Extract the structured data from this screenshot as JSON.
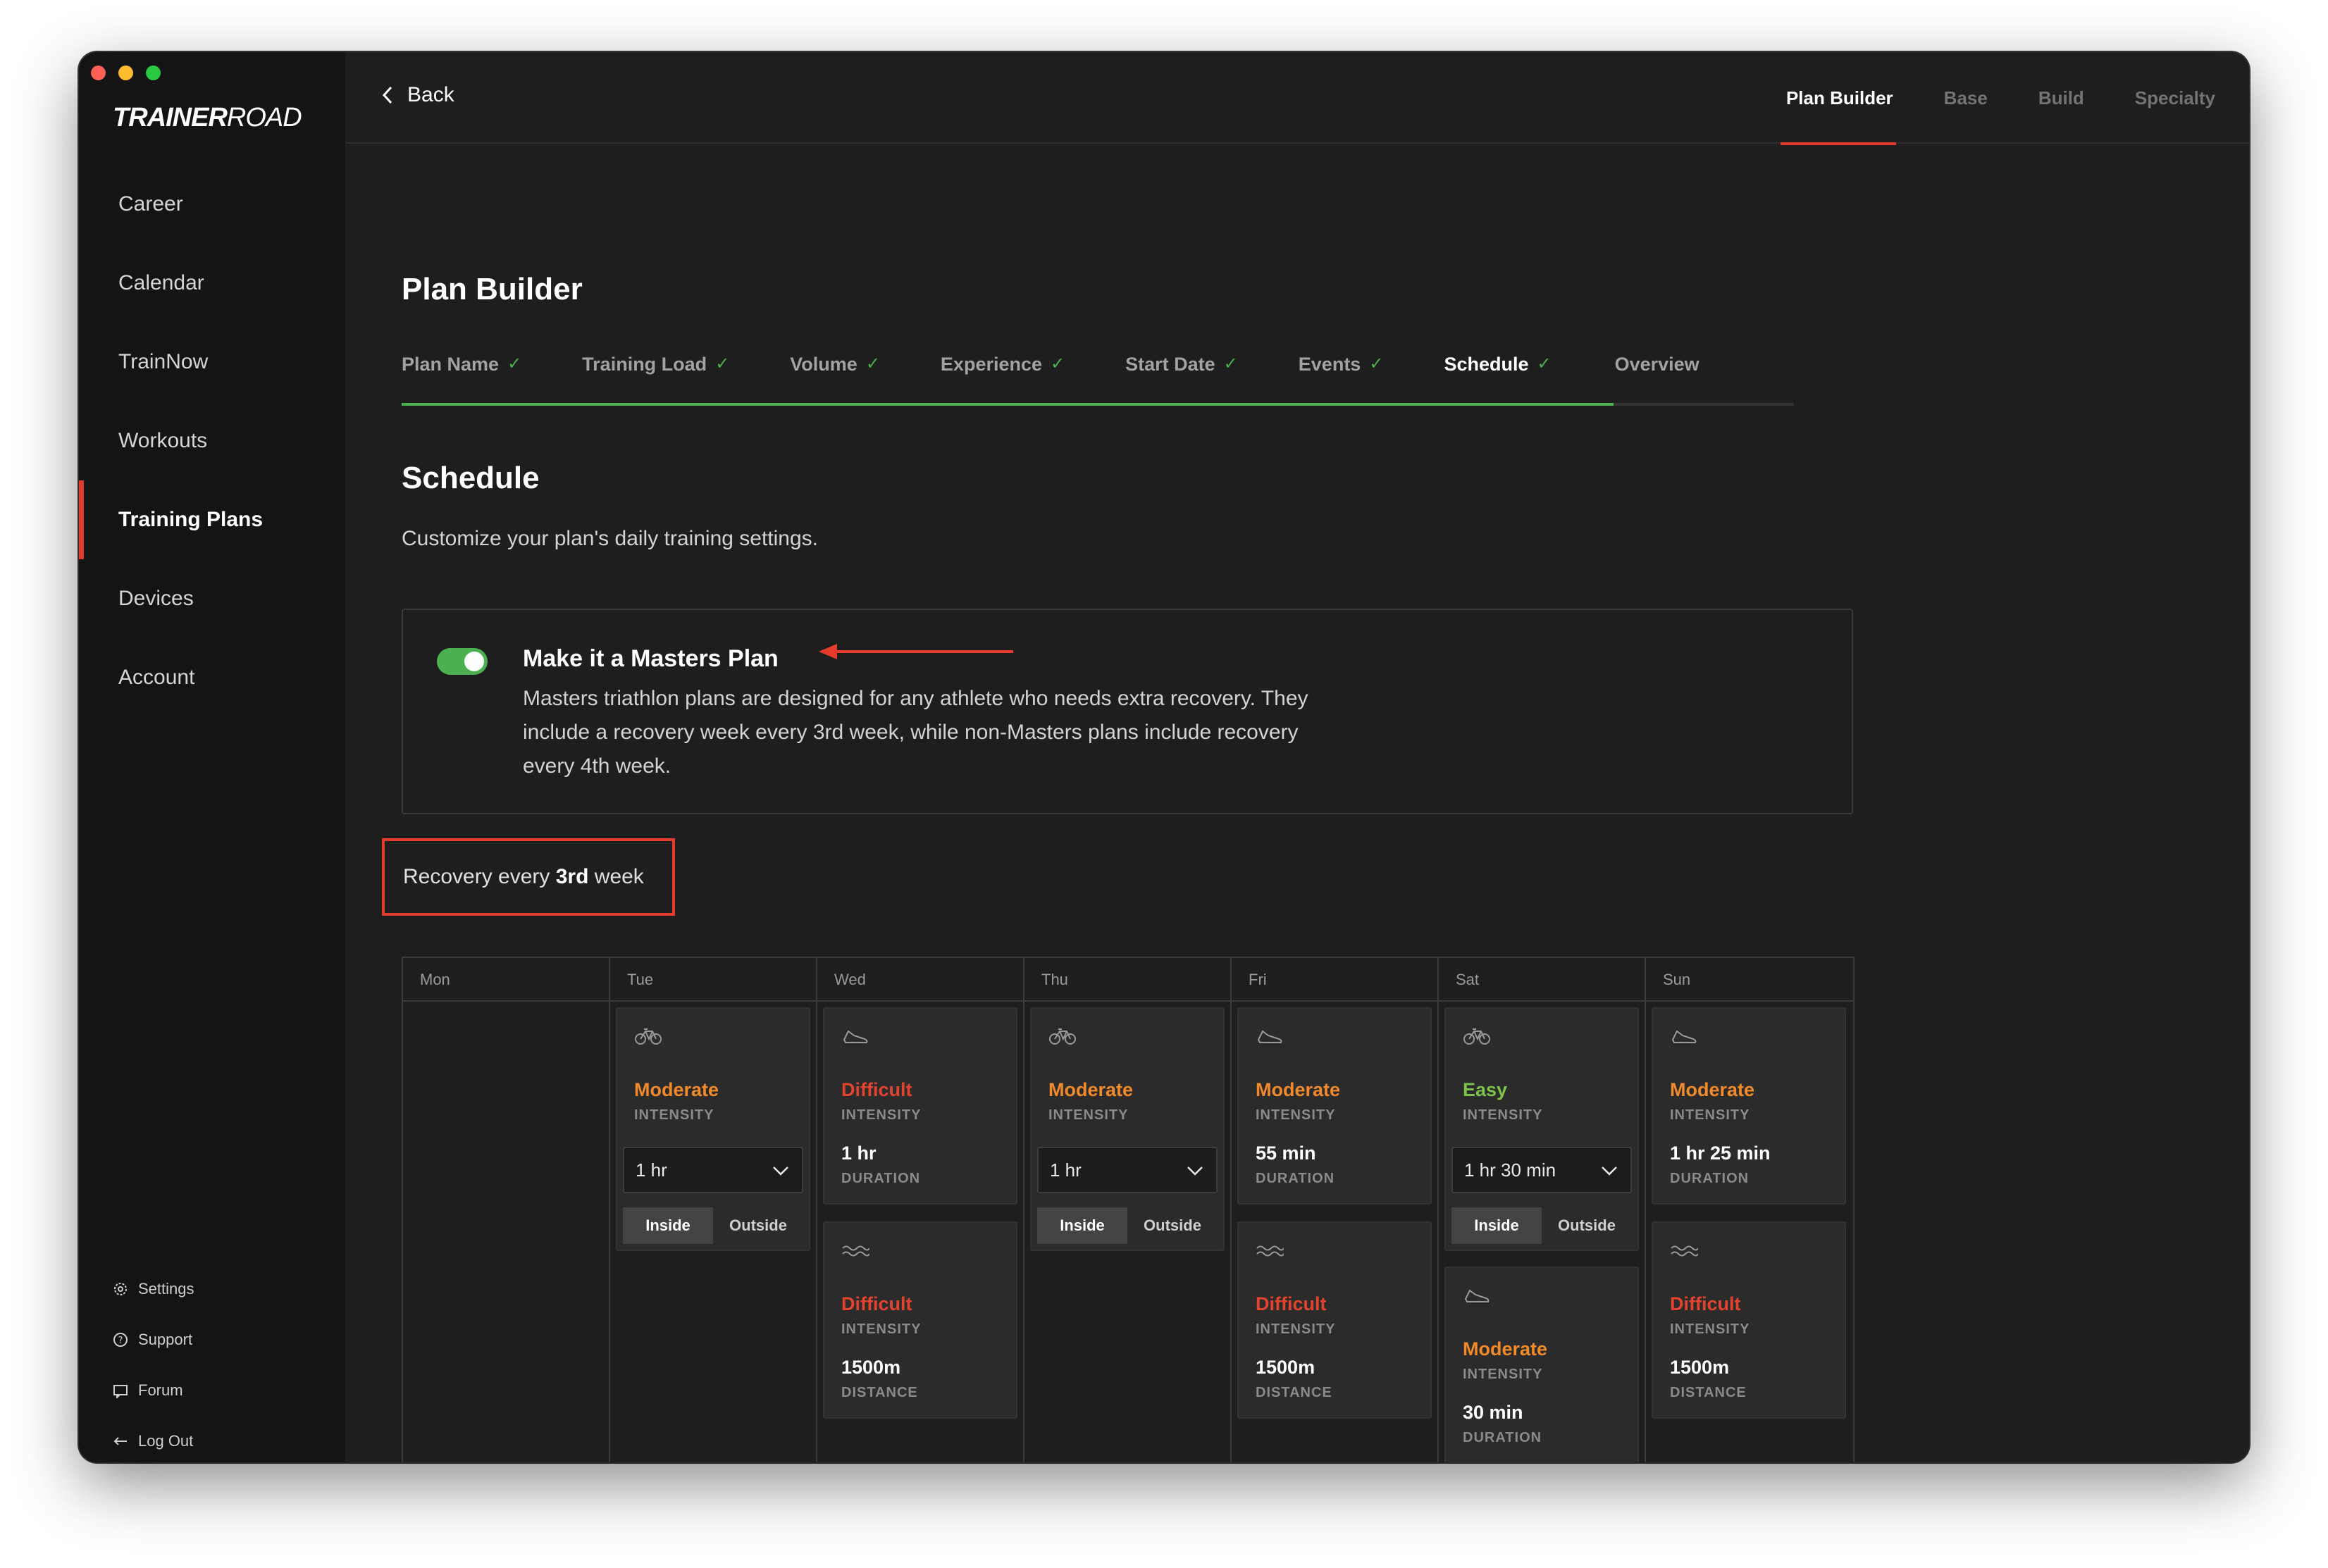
{
  "app": {
    "logo_bold": "TRAINER",
    "logo_light": "ROAD"
  },
  "sidebar": {
    "items": [
      {
        "label": "Career"
      },
      {
        "label": "Calendar"
      },
      {
        "label": "TrainNow"
      },
      {
        "label": "Workouts"
      },
      {
        "label": "Training Plans",
        "active": true
      },
      {
        "label": "Devices"
      },
      {
        "label": "Account"
      }
    ],
    "bottom": [
      {
        "label": "Settings",
        "icon": "gear-icon"
      },
      {
        "label": "Support",
        "icon": "help-icon"
      },
      {
        "label": "Forum",
        "icon": "chat-icon"
      },
      {
        "label": "Log Out",
        "icon": "logout-icon"
      }
    ]
  },
  "topbar": {
    "back_label": "Back",
    "tabs": [
      {
        "label": "Plan Builder",
        "active": true
      },
      {
        "label": "Base"
      },
      {
        "label": "Build"
      },
      {
        "label": "Specialty"
      }
    ]
  },
  "page": {
    "title": "Plan Builder",
    "steps": [
      {
        "label": "Plan Name",
        "done": true
      },
      {
        "label": "Training Load",
        "done": true
      },
      {
        "label": "Volume",
        "done": true
      },
      {
        "label": "Experience",
        "done": true
      },
      {
        "label": "Start Date",
        "done": true
      },
      {
        "label": "Events",
        "done": true
      },
      {
        "label": "Schedule",
        "done": true,
        "current": true
      },
      {
        "label": "Overview",
        "done": false
      }
    ],
    "check_glyph": "✓",
    "section_title": "Schedule",
    "section_desc": "Customize your plan's daily training settings."
  },
  "masters": {
    "toggle_on": true,
    "title": "Make it a Masters Plan",
    "description": "Masters triathlon plans are designed for any athlete who needs extra recovery. They include a recovery week every 3rd week, while non-Masters plans include recovery every 4th week."
  },
  "recovery": {
    "prefix": "Recovery every ",
    "value": "3rd",
    "suffix": " week"
  },
  "schedule": {
    "days": [
      "Mon",
      "Tue",
      "Wed",
      "Thu",
      "Fri",
      "Sat",
      "Sun"
    ],
    "labels": {
      "intensity": "INTENSITY",
      "duration": "DURATION",
      "distance": "DISTANCE",
      "inside": "Inside",
      "outside": "Outside"
    },
    "cards": {
      "tue_bike": {
        "intensity": "Moderate",
        "duration_select": "1 hr",
        "selected_location": "Inside"
      },
      "wed_run": {
        "intensity": "Difficult",
        "duration": "1 hr"
      },
      "wed_swim": {
        "intensity": "Difficult",
        "distance": "1500m"
      },
      "thu_bike": {
        "intensity": "Moderate",
        "duration_select": "1 hr",
        "selected_location": "Inside"
      },
      "fri_run": {
        "intensity": "Moderate",
        "duration": "55 min"
      },
      "fri_swim": {
        "intensity": "Difficult",
        "distance": "1500m"
      },
      "sat_bike": {
        "intensity": "Easy",
        "duration_select": "1 hr 30 min",
        "selected_location": "Inside"
      },
      "sat_run": {
        "intensity": "Moderate",
        "duration": "30 min"
      },
      "sun_run": {
        "intensity": "Moderate",
        "duration": "1 hr 25 min"
      },
      "sun_swim": {
        "intensity": "Difficult",
        "distance": "1500m"
      }
    }
  },
  "colors": {
    "accent_red": "#e03a2c",
    "success_green": "#4caf50",
    "moderate": "#f08a2a",
    "difficult": "#e2432f",
    "easy": "#7cc24b"
  }
}
